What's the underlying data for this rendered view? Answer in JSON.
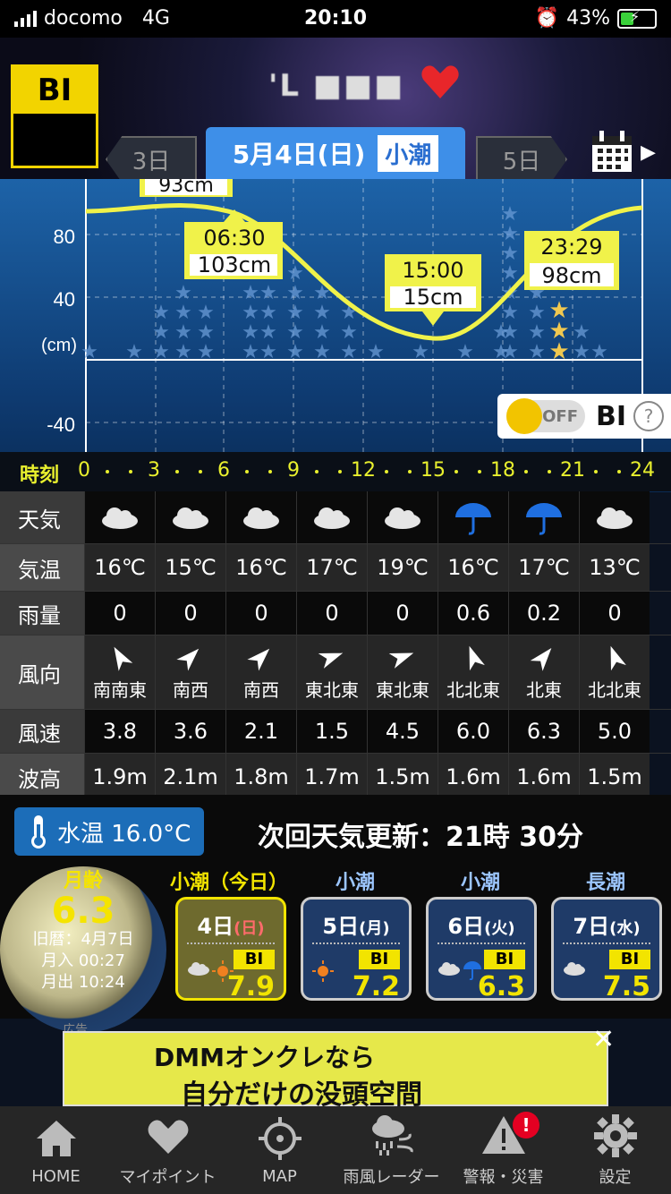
{
  "status_bar": {
    "carrier": "docomo",
    "network": "4G",
    "time": "20:10",
    "battery": "43%"
  },
  "header": {
    "logo_text": "BI",
    "title_obscured": "'L ■■■",
    "tabs": {
      "prev": "3日",
      "active_date": "5月4日(日)",
      "active_tide": "小潮",
      "next": "5日"
    }
  },
  "chart": {
    "y_ticks": [
      "80",
      "40",
      "(cm)",
      "-40"
    ],
    "annotations": [
      {
        "time": "",
        "height": "93cm"
      },
      {
        "time": "06:30",
        "height": "103cm"
      },
      {
        "time": "15:00",
        "height": "15cm"
      },
      {
        "time": "23:29",
        "height": "98cm"
      }
    ],
    "toggle": {
      "state": "OFF",
      "label": "BI",
      "help": "?"
    }
  },
  "time_axis": {
    "label": "時刻",
    "ticks": [
      "0",
      "3",
      "6",
      "9",
      "12",
      "15",
      "18",
      "21",
      "24"
    ]
  },
  "forecast": {
    "row_labels": [
      "天気",
      "気温",
      "雨量",
      "風向",
      "風速",
      "波高"
    ],
    "weather": [
      "cloud",
      "cloud",
      "cloud",
      "cloud",
      "cloud",
      "umbrella",
      "umbrella",
      "cloud"
    ],
    "temperature": [
      "16℃",
      "15℃",
      "16℃",
      "17℃",
      "19℃",
      "16℃",
      "17℃",
      "13℃"
    ],
    "rain": [
      "0",
      "0",
      "0",
      "0",
      "0",
      "0.6",
      "0.2",
      "0"
    ],
    "wind_dir": [
      "南南東",
      "南西",
      "南西",
      "東北東",
      "東北東",
      "北北東",
      "北東",
      "北北東"
    ],
    "wind_speed": [
      "3.8",
      "3.6",
      "2.1",
      "1.5",
      "4.5",
      "6.0",
      "6.3",
      "5.0"
    ],
    "wave": [
      "1.9m",
      "2.1m",
      "1.8m",
      "1.7m",
      "1.5m",
      "1.6m",
      "1.6m",
      "1.5m"
    ]
  },
  "info": {
    "water_temp": "水温 16.0°C",
    "update": "次回天気更新：21時 30分",
    "moon": {
      "age_label": "月齢",
      "age": "6.3",
      "lunar": "旧暦：4月7日",
      "moonrise": "月入 00:27",
      "moonset": "月出 10:24"
    },
    "days": [
      {
        "tide": "小潮（今日）",
        "date": "4日",
        "dow": "(日)",
        "bi": "7.9"
      },
      {
        "tide": "小潮",
        "date": "5日",
        "dow": "(月)",
        "bi": "7.2"
      },
      {
        "tide": "小潮",
        "date": "6日",
        "dow": "(火)",
        "bi": "6.3"
      },
      {
        "tide": "長潮",
        "date": "7日",
        "dow": "(水)",
        "bi": "7.5"
      }
    ],
    "bi_chip": "BI"
  },
  "ad": {
    "label": "広告",
    "title": "DMMオンクレなら",
    "subtitle": "自分だけの没頭空間",
    "close": "✕"
  },
  "nav": [
    "HOME",
    "マイポイント",
    "MAP",
    "雨風レーダー",
    "警報・災害",
    "設定"
  ],
  "nav_badge": "!"
}
